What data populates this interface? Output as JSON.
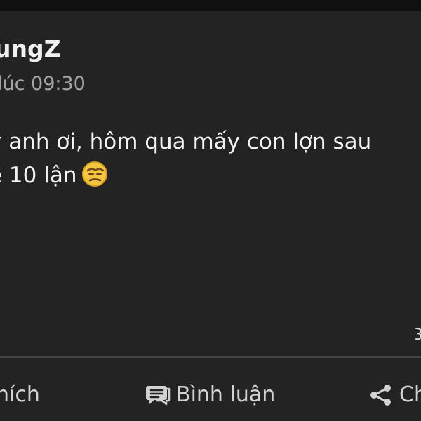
{
  "post": {
    "author": "ungZ",
    "timestamp": "lúc 09:30",
    "text_line_1": "y anh ơi, hôm qua mấy con lợn sau",
    "text_line_2": "ề 10 lận",
    "emoji_icon": "unamused-face-icon"
  },
  "actions": {
    "like_label": "hích",
    "comment_label": "Bình luận",
    "share_label": "Ch"
  },
  "colors": {
    "background": "#232323",
    "top_strip": "#101010",
    "primary_text": "#f3f3f3",
    "secondary_text": "#a4a4a4",
    "divider": "#454545",
    "action_text": "#d2d2d2"
  }
}
